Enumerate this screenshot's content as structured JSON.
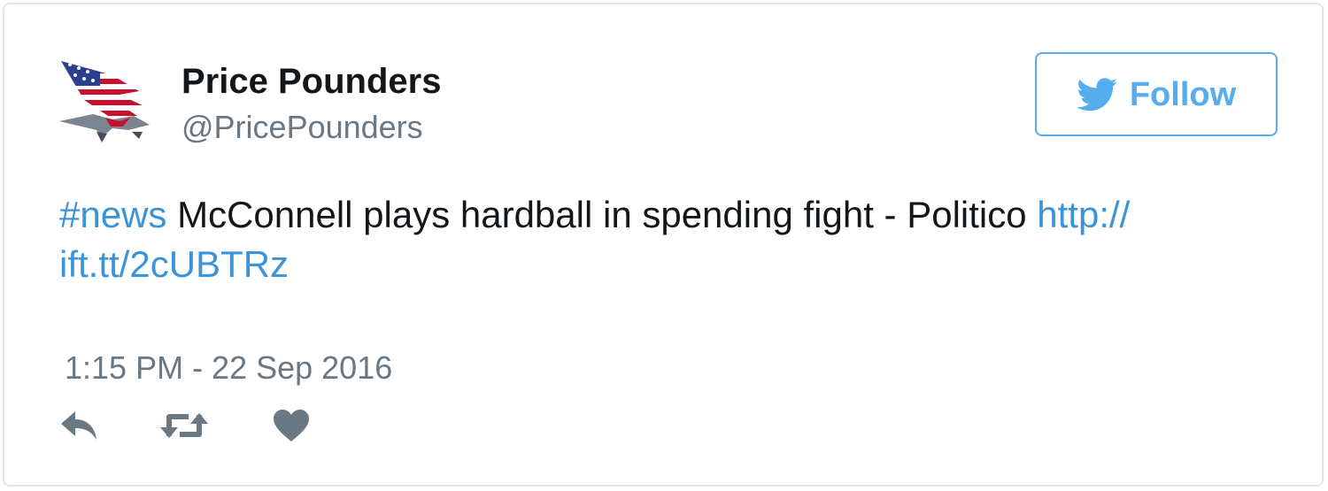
{
  "account": {
    "name": "Price Pounders",
    "handle": "@PricePounders",
    "avatar_icon": "flag-eagle-logo"
  },
  "follow_button": {
    "label": "Follow",
    "icon": "twitter-bird-icon",
    "color": "#55acee"
  },
  "tweet": {
    "hashtag": "#news",
    "text": " McConnell plays hardball in spending fight - Politico ",
    "link_line1": "http://",
    "link_line2": "ift.tt/2cUBTRz",
    "timestamp": "1:15 PM - 22 Sep 2016"
  },
  "actions": [
    {
      "icon": "reply-icon"
    },
    {
      "icon": "retweet-icon"
    },
    {
      "icon": "heart-icon"
    }
  ],
  "colors": {
    "text": "#14171a",
    "secondary": "#697882",
    "link": "#3b94d9",
    "border": "#e1e8ed"
  }
}
